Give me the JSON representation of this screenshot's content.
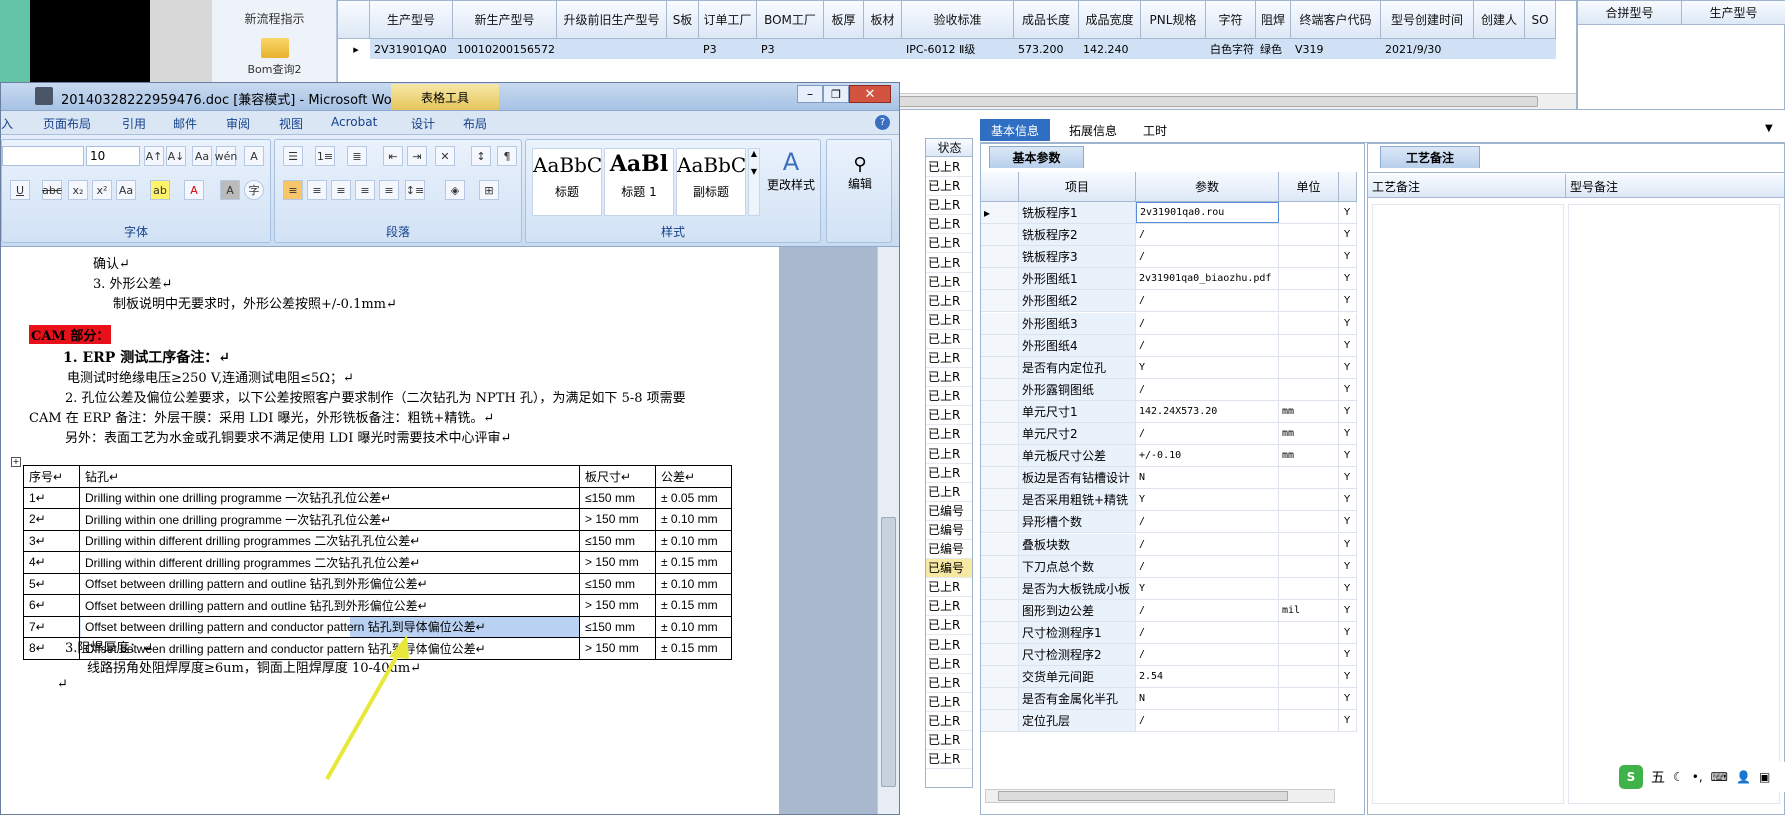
{
  "nav": {
    "item1": "新流程指示",
    "item2": "Bom查询2"
  },
  "top_grid": {
    "headers": [
      "生产型号",
      "新生产型号",
      "升级前旧生产型号",
      "S板",
      "订单工厂",
      "BOM工厂",
      "板厚",
      "板材",
      "验收标准",
      "成品长度",
      "成品宽度",
      "PNL规格",
      "字符",
      "阻焊",
      "终端客户代码",
      "型号创建时间",
      "创建人",
      "SO"
    ],
    "row": [
      "2V31901QA0",
      "10010200156572",
      "",
      "",
      "P3",
      "P3",
      "",
      "",
      "IPC-6012 Ⅱ级",
      "573.200",
      "142.240",
      "",
      "白色字符",
      "绿色",
      "V319",
      "2021/9/30",
      "",
      ""
    ],
    "right_headers": [
      "合拼型号",
      "生产型号"
    ]
  },
  "word": {
    "title": "20140328222959476.doc [兼容模式] - Microsoft Wo...",
    "context_tab": "表格工具",
    "tabs": [
      "入",
      "页面布局",
      "引用",
      "邮件",
      "审阅",
      "视图",
      "Acrobat",
      "设计",
      "布局"
    ],
    "font_size": "10",
    "groups": {
      "font": "字体",
      "paragraph": "段落",
      "styles": "样式"
    },
    "style_samples": [
      {
        "preview": "AaBbC",
        "name": "标题"
      },
      {
        "preview": "AaBl",
        "name": "标题 1"
      },
      {
        "preview": "AaBbC",
        "name": "副标题"
      }
    ],
    "change_styles": "更改样式",
    "edit": "编辑"
  },
  "doc": {
    "l1": "确认↵",
    "l2": "3.  外形公差↵",
    "l3": "制板说明中无要求时，外形公差按照+/-0.1mm↵",
    "cam": "CAM 部分：",
    "h1": "1.  ERP 测试工序备注：↵",
    "l4": "电测试时绝缘电压≥250 V,连通测试电阻≤5Ω；↵",
    "l5": "2.  孔位公差及偏位公差要求，以下公差按照客户要求制作（二次钻孔为 NPTH 孔），为满足如下 5-8 项需要",
    "l6": "CAM 在 ERP 备注：外层干膜：采用 LDI 曝光，外形铣板备注：粗铣+精铣。↵",
    "l7": "另外：表面工艺为水金或孔铜要求不满足使用 LDI 曝光时需要技术中心评审↵",
    "table_headers": [
      "序号↵",
      "钻孔↵",
      "板尺寸↵",
      "公差↵"
    ],
    "table_rows": [
      [
        "1↵",
        "Drilling within one drilling programme 一次钻孔孔位公差↵",
        "≤150 mm",
        "± 0.05 mm"
      ],
      [
        "2↵",
        "Drilling within one drilling programme 一次钻孔孔位公差↵",
        "> 150 mm",
        "± 0.10 mm"
      ],
      [
        "3↵",
        "Drilling within different drilling programmes 二次钻孔孔位公差↵",
        "≤150 mm",
        "± 0.10 mm"
      ],
      [
        "4↵",
        "Drilling within different drilling programmes 二次钻孔孔位公差↵",
        "> 150 mm",
        "± 0.15 mm"
      ],
      [
        "5↵",
        "Offset between drilling pattern and outline 钻孔到外形偏位公差↵",
        "≤150 mm",
        "± 0.10 mm"
      ],
      [
        "6↵",
        "Offset between drilling pattern and outline 钻孔到外形偏位公差↵",
        "> 150 mm",
        "± 0.15 mm"
      ],
      [
        "7↵",
        "Offset between drilling pattern and conductor pattern 钻孔到导体偏位公差↵",
        "≤150 mm",
        "± 0.10 mm"
      ],
      [
        "8↵",
        "Offset between drilling pattern and conductor pattern 钻孔到导体偏位公差↵",
        "> 150 mm",
        "± 0.15 mm"
      ]
    ],
    "l8": "3.阻焊厚度：↵",
    "l9": "线路拐角处阻焊厚度≥6um，铜面上阻焊厚度 10-40um↵"
  },
  "status": {
    "header": "状态",
    "items": [
      "已上R",
      "已上R",
      "已上R",
      "已上R",
      "已上R",
      "已上R",
      "已上R",
      "已上R",
      "已上R",
      "已上R",
      "已上R",
      "已上R",
      "已上R",
      "已上R",
      "已上R",
      "已上R",
      "已上R",
      "已上R",
      "已编号",
      "已编号",
      "已编号",
      "已编号",
      "已上R",
      "已上R",
      "已上R",
      "已上R",
      "已上R",
      "已上R",
      "已上R",
      "已上R",
      "已上R",
      "已上R"
    ]
  },
  "info_tabs": [
    "基本信息",
    "拓展信息",
    "工时"
  ],
  "basic": {
    "title": "基本参数",
    "headers": [
      "项目",
      "参数",
      "单位"
    ],
    "rows": [
      [
        "铣板程序1",
        "2v31901qa0.rou",
        "",
        "Y"
      ],
      [
        "铣板程序2",
        "/",
        "",
        "Y"
      ],
      [
        "铣板程序3",
        "/",
        "",
        "Y"
      ],
      [
        "外形图纸1",
        "2v31901qa0_biaozhu.pdf",
        "",
        "Y"
      ],
      [
        "外形图纸2",
        "/",
        "",
        "Y"
      ],
      [
        "外形图纸3",
        "/",
        "",
        "Y"
      ],
      [
        "外形图纸4",
        "/",
        "",
        "Y"
      ],
      [
        "是否有内定位孔",
        "Y",
        "",
        "Y"
      ],
      [
        "外形露铜图纸",
        "/",
        "",
        "Y"
      ],
      [
        "单元尺寸1",
        "142.24X573.20",
        "mm",
        "Y"
      ],
      [
        "单元尺寸2",
        "/",
        "mm",
        "Y"
      ],
      [
        "单元板尺寸公差",
        "+/-0.10",
        "mm",
        "Y"
      ],
      [
        "板边是否有钻槽设计",
        "N",
        "",
        "Y"
      ],
      [
        "是否采用粗铣+精铣",
        "Y",
        "",
        "Y"
      ],
      [
        "异形槽个数",
        "/",
        "",
        "Y"
      ],
      [
        "叠板块数",
        "/",
        "",
        "Y"
      ],
      [
        "下刀点总个数",
        "/",
        "",
        "Y"
      ],
      [
        "是否为大板铣成小板",
        "Y",
        "",
        "Y"
      ],
      [
        "图形到边公差",
        "/",
        "mil",
        "Y"
      ],
      [
        "尺寸检测程序1",
        "/",
        "",
        "Y"
      ],
      [
        "尺寸检测程序2",
        "/",
        "",
        "Y"
      ],
      [
        "交货单元间距",
        "2.54",
        "",
        "Y"
      ],
      [
        "是否有金属化半孔",
        "N",
        "",
        "Y"
      ],
      [
        "定位孔层",
        "/",
        "",
        "Y"
      ]
    ]
  },
  "craft": {
    "title": "工艺备注",
    "col1": "工艺备注",
    "col2": "型号备注"
  },
  "ime": {
    "label": "五"
  }
}
